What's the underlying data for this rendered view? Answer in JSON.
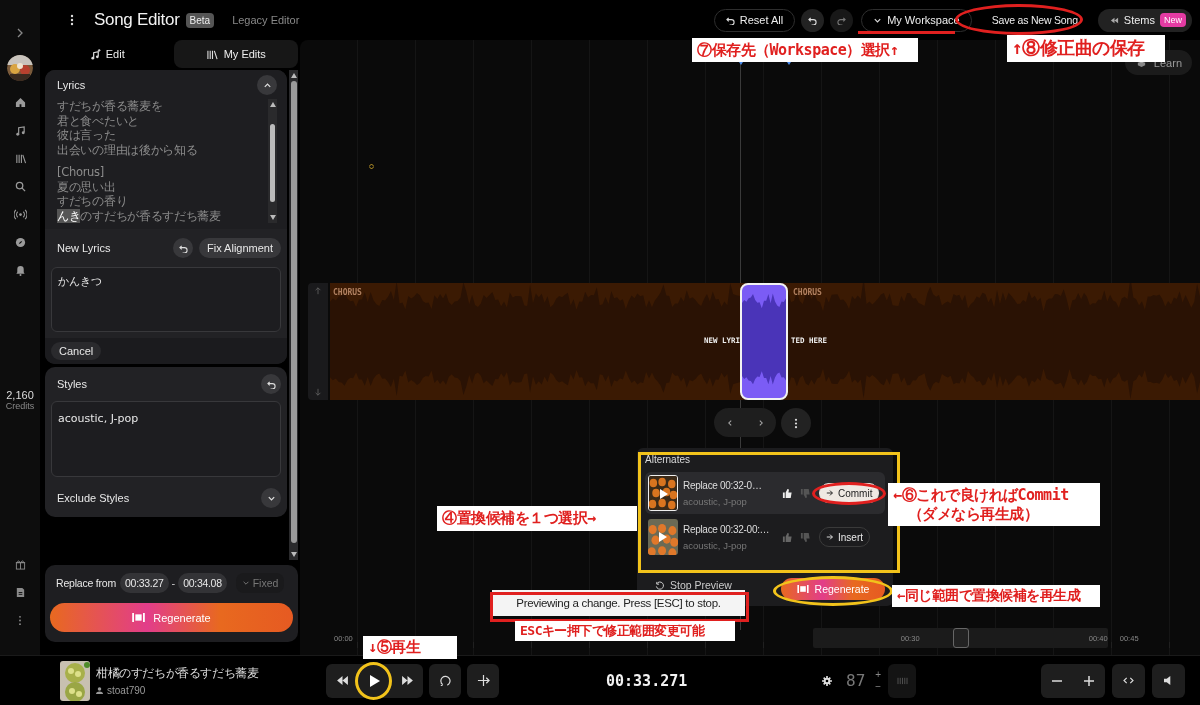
{
  "rail": {
    "credits": "2,160",
    "credits_label": "Credits"
  },
  "header": {
    "title": "Song Editor",
    "badge": "Beta",
    "legacy_link": "Legacy Editor",
    "reset": "Reset All",
    "workspace": "My Workspace",
    "save": "Save as New Song",
    "stems": "Stems",
    "stems_badge": "New"
  },
  "tabs": [
    {
      "label": "Edit",
      "selected": true
    },
    {
      "label": "My Edits",
      "selected": false
    }
  ],
  "lyrics": {
    "title": "Lyrics",
    "expanded": true,
    "stanzas": [
      [
        {
          "text": "すだちが香る蕎麦を"
        },
        {
          "text": "君と食べたいと"
        },
        {
          "text": "彼は言った"
        },
        {
          "text": "出会いの理由は後から知る"
        }
      ],
      [
        {
          "text": "[Chorus]"
        },
        {
          "text": "夏の思い出"
        },
        {
          "text": "すだちの香り"
        },
        {
          "marked": "んき",
          "text": "のすだちが香るすだち蕎麦"
        }
      ]
    ]
  },
  "new_lyrics": {
    "label": "New Lyrics",
    "fix": "Fix Alignment",
    "value": "かんきつ",
    "cancel": "Cancel"
  },
  "styles": {
    "label": "Styles",
    "value": "acoustic, J-pop",
    "exclude": "Exclude Styles",
    "exclude_expanded": false
  },
  "replace": {
    "label": "Replace from",
    "start": "00:33.27",
    "separator": "-",
    "end": "00:34.08",
    "mode": "Fixed",
    "regenerate": "Regenerate"
  },
  "track": {
    "section_labels": [
      "CHORUS",
      "CHORUS"
    ],
    "banner_left": "NEW LYRI",
    "banner_right": "TED HERE"
  },
  "learn": "Learn",
  "alternates": {
    "title": "Alternates",
    "items": [
      {
        "title": "Replace 00:32-0…",
        "styles": "acoustic, J-pop",
        "action": "Commit",
        "selected": true
      },
      {
        "title": "Replace 00:32-00:…",
        "styles": "acoustic, J-pop",
        "action": "Insert",
        "selected": false
      }
    ],
    "stop_preview": "Stop Preview",
    "regenerate": "Regenerate"
  },
  "toast": "Previewing a change. Press [ESC] to stop.",
  "ruler": {
    "start": "00:00",
    "minimap_ticks": [
      "00:30",
      "00:40"
    ],
    "end": "00:45"
  },
  "player": {
    "song_title": "柑橘のすだちが香るすだち蕎麦",
    "user": "stoat790",
    "time": "00:33.271",
    "bpm": "87",
    "bpm_up": "+",
    "bpm_down": "−"
  },
  "annotations": [
    {
      "kind": "label",
      "text": "⑦保存先（Workspace）選択↑"
    },
    {
      "kind": "label",
      "text": "↑⑧修正曲の保存"
    },
    {
      "kind": "label",
      "text": "④置換候補を１つ選択→"
    },
    {
      "kind": "label",
      "text": "←⑥これで良ければCommit\n　（ダメなら再生成）"
    },
    {
      "kind": "label",
      "text": "←同じ範囲で置換候補を再生成"
    },
    {
      "kind": "label",
      "text": "ESCキー押下で修正範囲変更可能"
    },
    {
      "kind": "label",
      "text": "↓⑤再生"
    }
  ],
  "marks": [
    {
      "kind": "ellipse",
      "color": "#e0201f"
    },
    {
      "kind": "underline",
      "color": "#e0201f"
    },
    {
      "kind": "rect",
      "color": "#f2c31b"
    },
    {
      "kind": "ellipse",
      "color": "#e0201f"
    },
    {
      "kind": "ellipse",
      "color": "#f2c31b"
    },
    {
      "kind": "rect",
      "color": "#e0201f"
    },
    {
      "kind": "ellipse",
      "color": "#f2c31b"
    }
  ]
}
